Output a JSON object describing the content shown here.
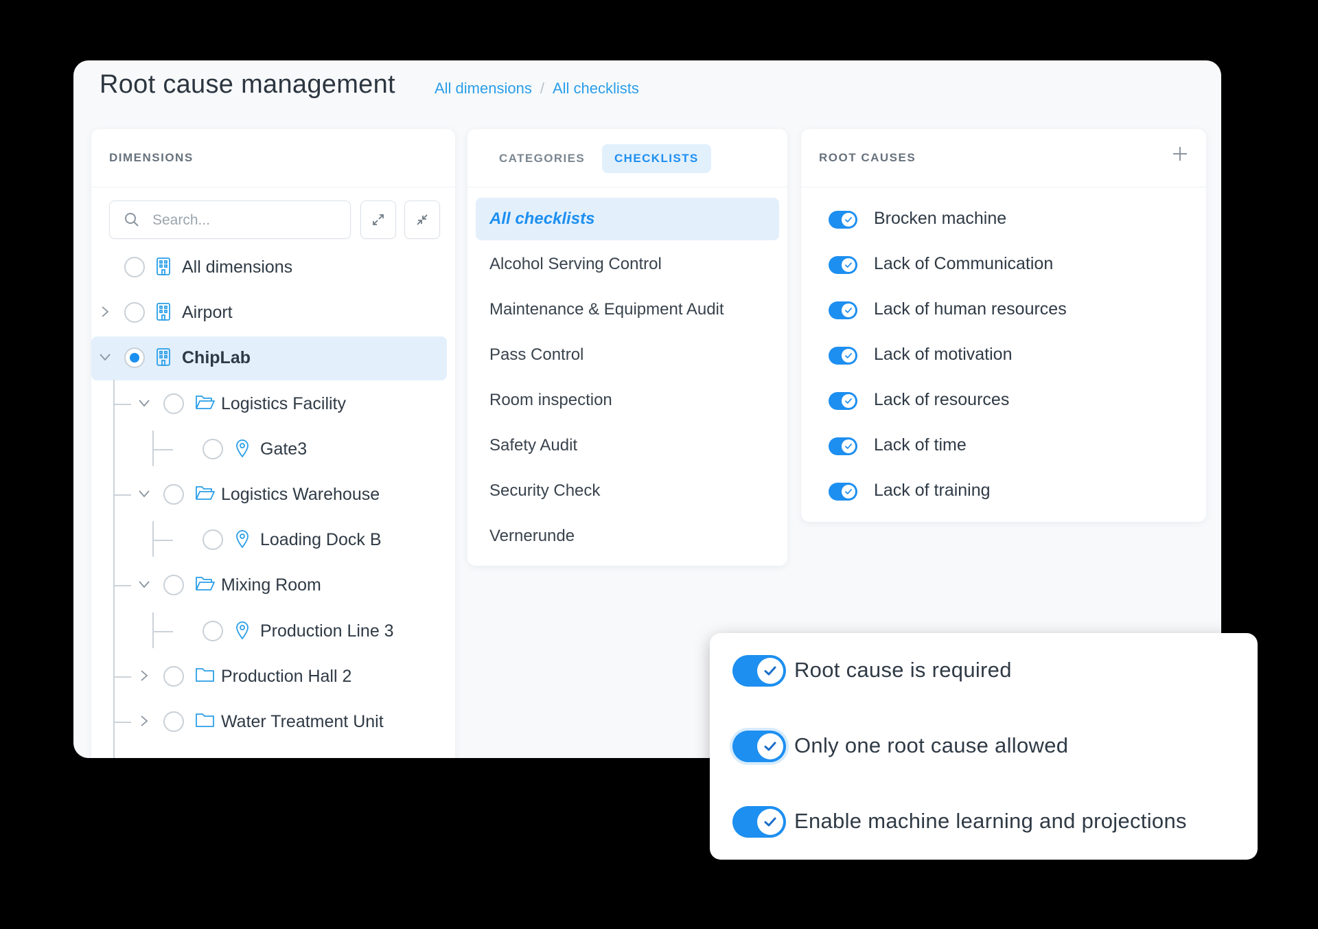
{
  "header": {
    "title": "Root cause management",
    "breadcrumb": [
      "All dimensions",
      "All checklists"
    ],
    "separator": "/"
  },
  "dimensions": {
    "title": "DIMENSIONS",
    "search_placeholder": "Search...",
    "search_value": "",
    "tree": [
      {
        "label": "All dimensions",
        "icon": "building-icon",
        "expander": "none",
        "selected": false
      },
      {
        "label": "Airport",
        "icon": "building-icon",
        "expander": "collapsed",
        "selected": false
      },
      {
        "label": "ChipLab",
        "icon": "building-icon",
        "expander": "expanded",
        "selected": true
      },
      {
        "label": "Logistics Facility",
        "icon": "folder-open-icon",
        "expander": "expanded",
        "selected": false
      },
      {
        "label": "Gate3",
        "icon": "location-pin-icon",
        "expander": "none",
        "selected": false
      },
      {
        "label": "Logistics Warehouse",
        "icon": "folder-open-icon",
        "expander": "expanded",
        "selected": false
      },
      {
        "label": "Loading Dock B",
        "icon": "location-pin-icon",
        "expander": "none",
        "selected": false
      },
      {
        "label": "Mixing Room",
        "icon": "folder-open-icon",
        "expander": "expanded",
        "selected": false
      },
      {
        "label": "Production Line 3",
        "icon": "location-pin-icon",
        "expander": "none",
        "selected": false
      },
      {
        "label": "Production Hall 2",
        "icon": "folder-icon",
        "expander": "collapsed",
        "selected": false
      },
      {
        "label": "Water Treatment Unit",
        "icon": "folder-icon",
        "expander": "collapsed",
        "selected": false
      }
    ]
  },
  "checklists": {
    "tabs": [
      "CATEGORIES",
      "CHECKLISTS"
    ],
    "active_tab": "CHECKLISTS",
    "items": [
      "All checklists",
      "Alcohol Serving Control",
      "Maintenance & Equipment Audit",
      "Pass Control",
      "Room inspection",
      "Safety Audit",
      "Security Check",
      "Vernerunde"
    ],
    "selected": "All checklists"
  },
  "root_causes": {
    "title": "ROOT CAUSES",
    "items": [
      "Brocken machine",
      "Lack of Communication",
      "Lack of human resources",
      "Lack of motivation",
      "Lack of resources",
      "Lack of time",
      "Lack of training"
    ]
  },
  "settings": {
    "items": [
      "Root cause is required",
      "Only one root cause allowed",
      "Enable machine learning and projections"
    ]
  },
  "colors": {
    "accent": "#1d8ff0",
    "selected_bg": "#e3f0fc",
    "link": "#2a9ee8"
  }
}
